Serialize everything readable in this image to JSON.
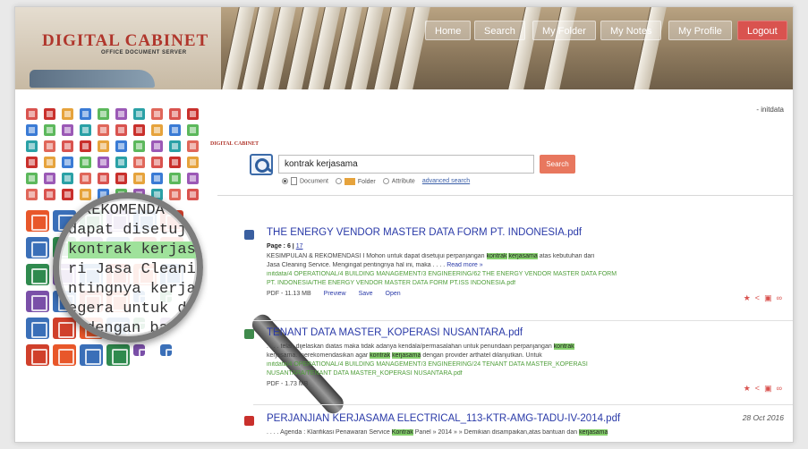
{
  "app": {
    "logo": "DIGITAL CABINET",
    "logo_sub": "OFFICE DOCUMENT SERVER",
    "mini_logo": "DIGITAL CABINET"
  },
  "nav": {
    "home": "Home",
    "search": "Search",
    "my_folder": "My Folder",
    "my_notes": "My Notes",
    "my_profile": "My Profile",
    "logout": "Logout"
  },
  "user": "- initdata",
  "search": {
    "query": "kontrak kerjasama",
    "button": "Search",
    "opt_document": "Document",
    "opt_folder": "Folder",
    "opt_attribute": "Attribute",
    "advanced": "advanced search"
  },
  "magnifier": {
    "lines": [
      "REKOMENDA",
      "dapat disetujui per",
      "kontrak kerjasama",
      "ri Jasa Cleaning Ser",
      "ntingnya kerjasama",
      "egera untuk dila",
      "dengan bai"
    ]
  },
  "results": [
    {
      "title": "THE ENERGY VENDOR MASTER DATA FORM PT.      INDONESIA.pdf",
      "page_label": "Page : 6 |",
      "page_link": "17",
      "s1_pre": "KESIMPULAN & REKOMENDASI I Mohon untuk dapat disetujui perpanjangan ",
      "s1_hl1": "kontrak",
      "s1_hl2": "kerjasama",
      "s1_post": " atas kebutuhan dari",
      "s2": "Jasa Cleaning Service. Mengingat pentingnya hal ini, maka . . . .",
      "s2_more": "Read more »",
      "path1": "initdata/4 OPERATIONAL/4 BUILDING MANAGEMENT/3 ENGINEERING/62 THE ENERGY VENDOR MASTER DATA FORM",
      "path2": "PT.     INDONESIA/THE ENERGY VENDOR MASTER DATA FORM PT.ISS INDONESIA.pdf",
      "meta": "PDF - 11.13 MB",
      "preview": "Preview",
      "save": "Save",
      "open": "Open"
    },
    {
      "title": "TENANT DATA MASTER_KOPERASI NUSANTARA.pdf",
      "s1": ". . . . telah dijelaskan diatas maka tidak adanya kendala/permasalahan untuk penundaan perpanjangan ",
      "s1_hl": "kontrak",
      "s2_pre": "kerjasama. merekomendasikan agar ",
      "s2_hl1": "kontrak",
      "s2_hl2": "kerjasama",
      "s2_post": " dengan provider arthatel dilanjutkan. Untuk",
      "path1": "initdata/4 OPERATIONAL/4 BUILDING MANAGEMENT/3 ENGINEERING/24 TENANT DATA MASTER_KOPERASI",
      "path2": "NUSANTARA/TENANT DATA MASTER_KOPERASI NUSANTARA.pdf",
      "meta": "PDF - 1.73 MB"
    },
    {
      "title": "PERJANJIAN KERJASAMA ELECTRICAL_113-KTR-AMG-TADU-IV-2014.pdf",
      "date": "28 Oct 2016",
      "s1_pre": ". . . . Agenda : Klarifikasi Penawaran Service ",
      "s1_hl": "Kontrak",
      "s1_mid": " Panel » 2014 » » Demikian disampaikan,atas bantuan dan ",
      "s1_hl2": "kerjasama"
    }
  ],
  "colors": {
    "accent": "#2a3aa8",
    "highlight": "#86d16d",
    "logout": "#d9534f",
    "search_button": "#e8775e"
  }
}
